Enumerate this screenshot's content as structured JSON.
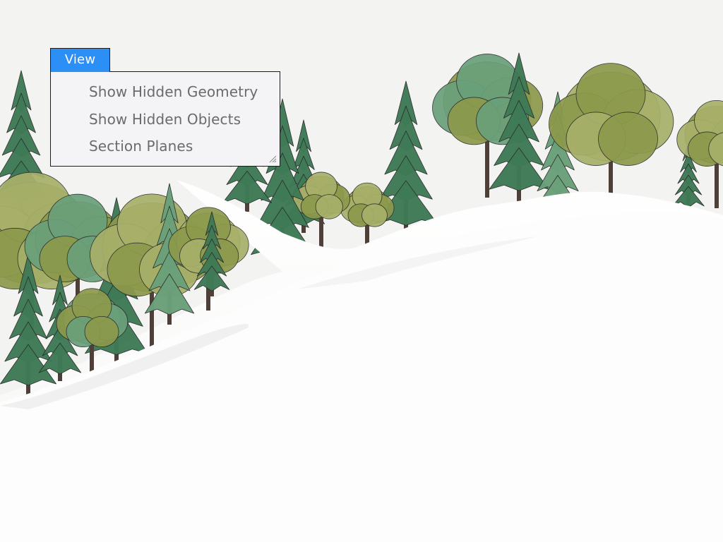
{
  "menu_bar": {
    "view_label": "View"
  },
  "view_menu": {
    "items": [
      {
        "label": "Show Hidden Geometry"
      },
      {
        "label": "Show Hidden Objects"
      },
      {
        "label": "Section Planes"
      }
    ]
  },
  "scene": {
    "description_icons": [
      "tree-icon",
      "snow-hill-icon"
    ],
    "colors": {
      "background": "#f3f3f2",
      "snow": "#ffffff",
      "pine_dark": "#3f7a56",
      "pine_light": "#6aa07a",
      "deciduous_olive": "#8c9a4c",
      "deciduous_light": "#a8b06a",
      "trunk": "#4e4038",
      "outline": "#2a2a2a",
      "menu_accent": "#2b8ff5"
    }
  }
}
